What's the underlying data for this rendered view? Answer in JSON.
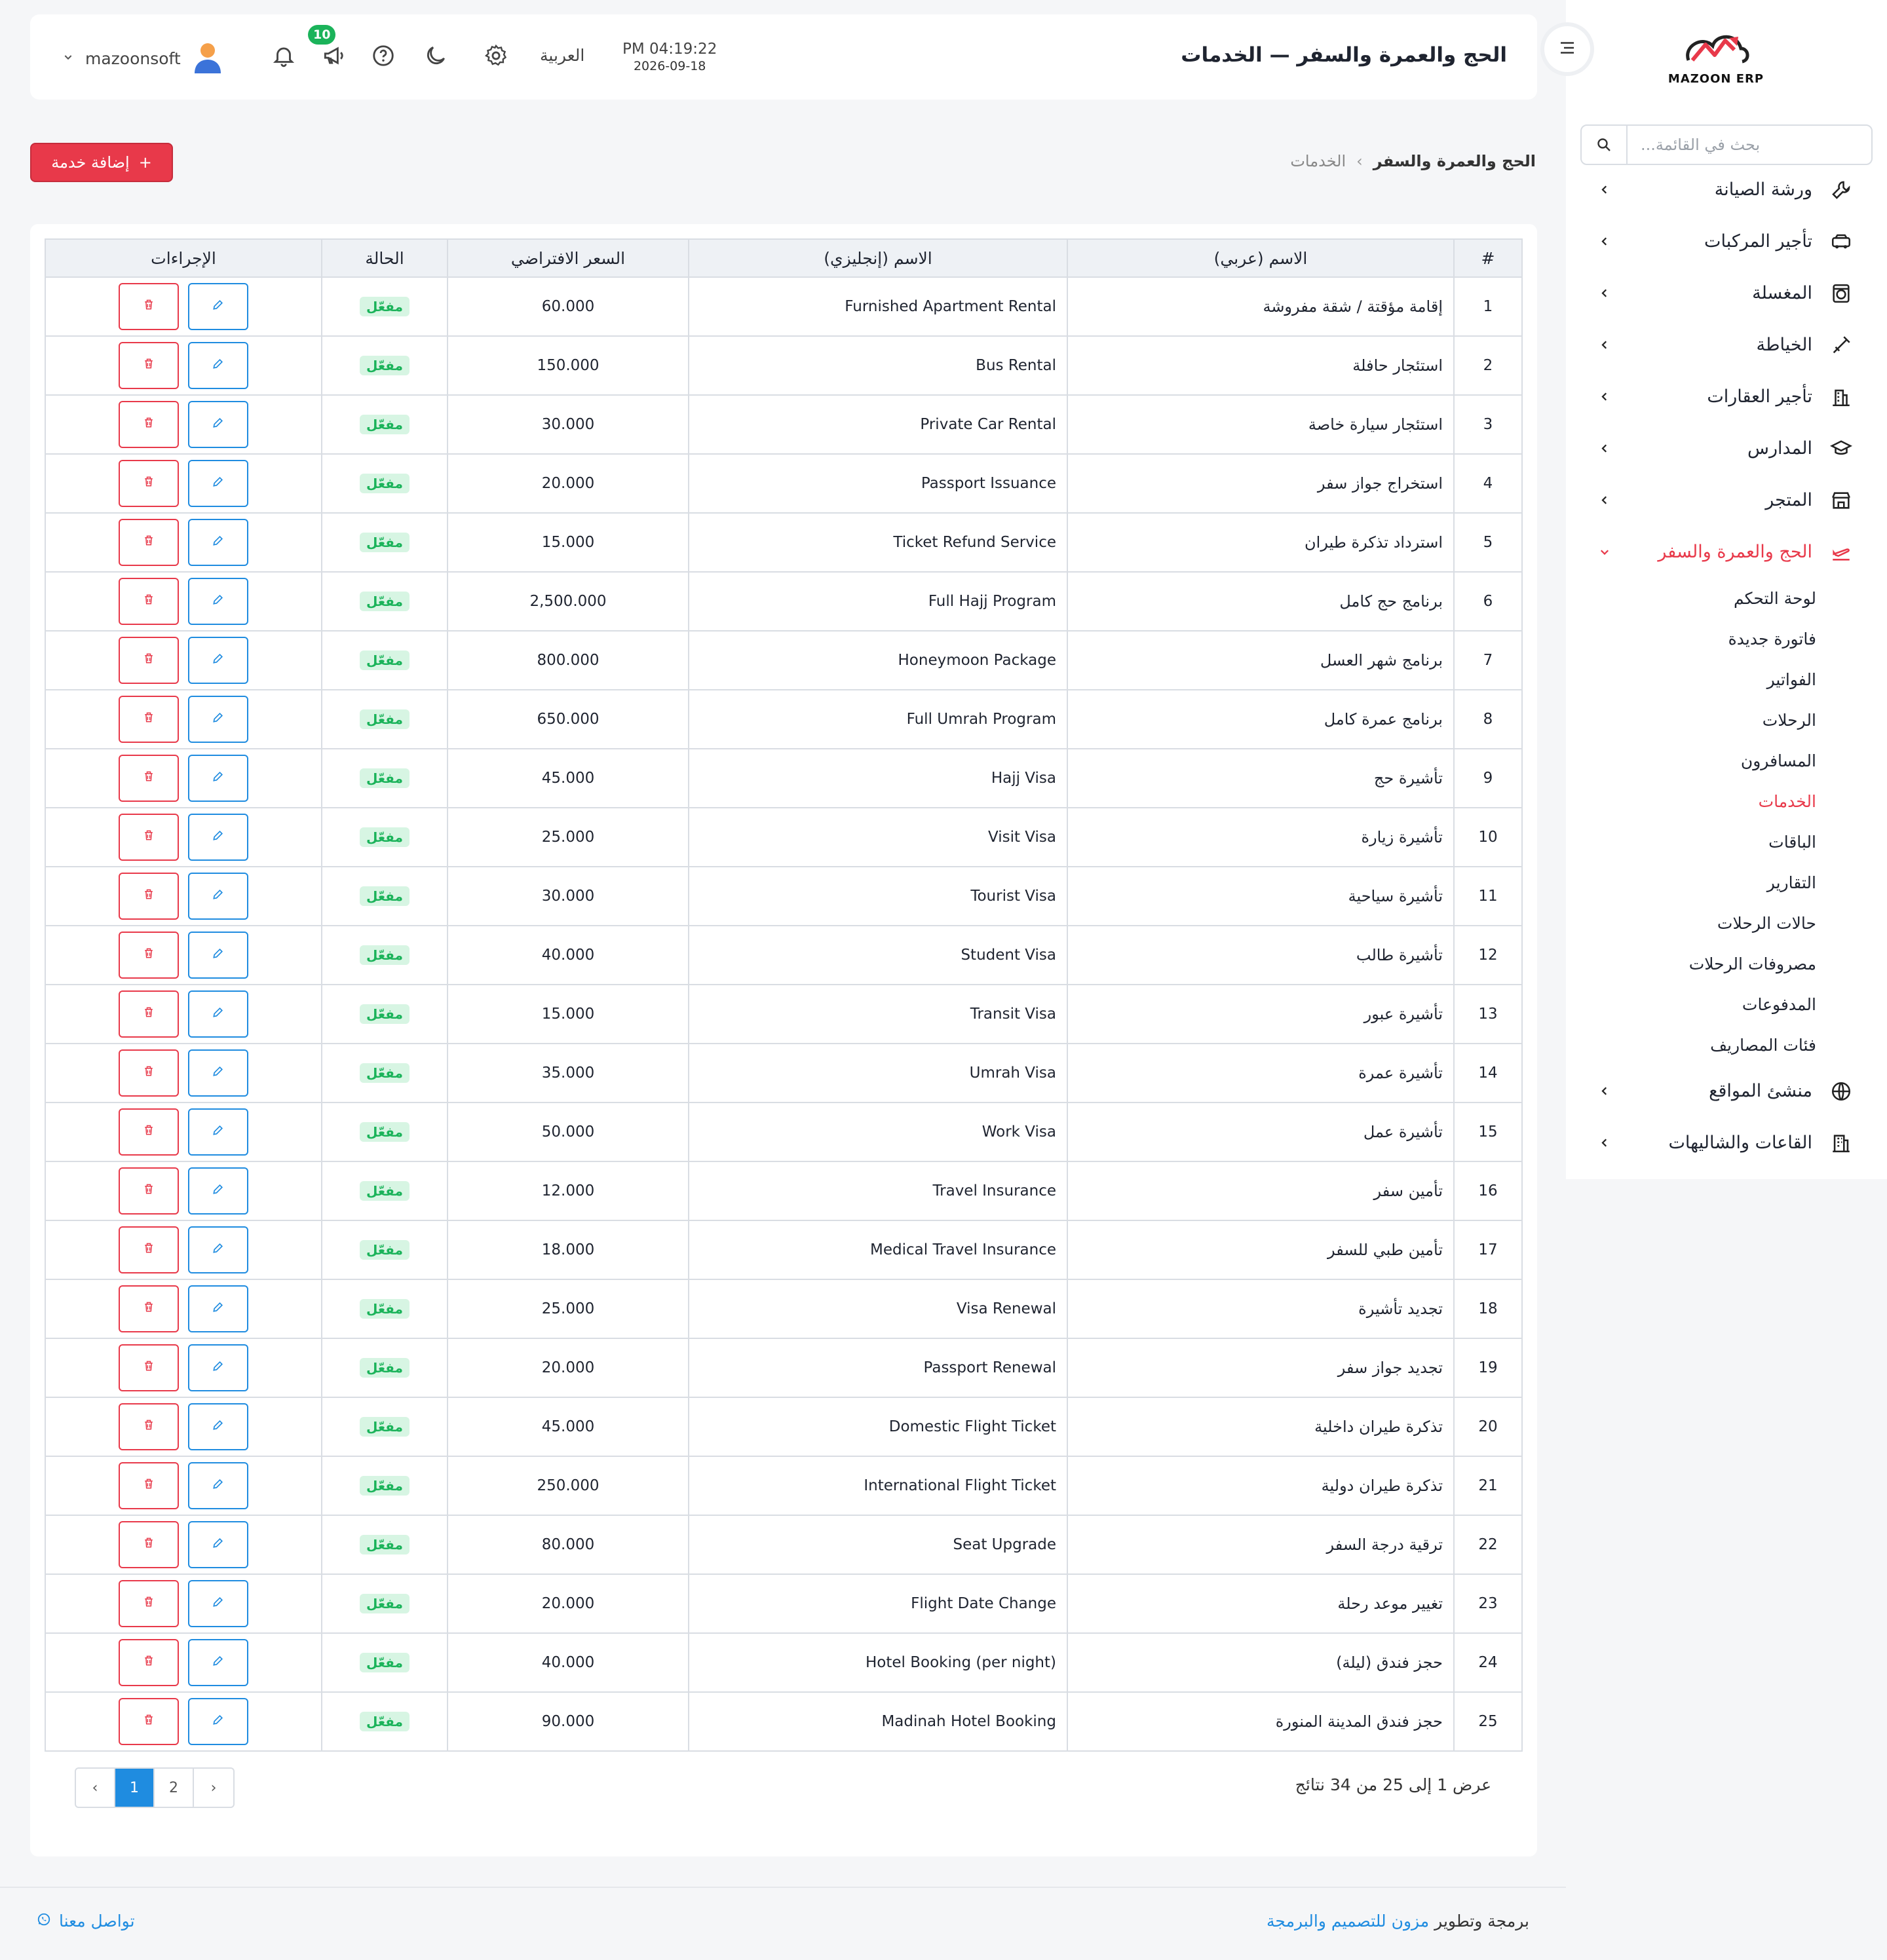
{
  "app": {
    "logo_text": "MAZOON ERP"
  },
  "sidebar": {
    "search_placeholder": "بحث في القائمة...",
    "items": [
      {
        "label": "ورشة الصيانة",
        "icon": "wrench-icon"
      },
      {
        "label": "تأجير المركبات",
        "icon": "car-icon"
      },
      {
        "label": "المغسلة",
        "icon": "washer-icon"
      },
      {
        "label": "الخياطة",
        "icon": "needle-icon"
      },
      {
        "label": "تأجير العقارات",
        "icon": "building-icon"
      },
      {
        "label": "المدارس",
        "icon": "graduation-cap-icon"
      },
      {
        "label": "المتجر",
        "icon": "store-icon"
      },
      {
        "label": "الحج والعمرة والسفر",
        "icon": "plane-icon"
      },
      {
        "label": "منشئ المواقع",
        "icon": "globe-icon"
      },
      {
        "label": "القاعات والشاليهات",
        "icon": "hall-icon"
      }
    ],
    "submenu": [
      "لوحة التحكم",
      "فاتورة جديدة",
      "الفواتير",
      "الرحلات",
      "المسافرون",
      "الخدمات",
      "الباقات",
      "التقارير",
      "حالات الرحلات",
      "مصروفات الرحلات",
      "المدفوعات",
      "فئات المصاريف"
    ],
    "active_sub_index": 5
  },
  "header": {
    "title": "الحج والعمرة والسفر — الخدمات",
    "time": "PM 04:19:22",
    "date": "2026-09-18",
    "language": "العربية",
    "notifications_count": "10",
    "username": "mazoonsoft"
  },
  "breadcrumb": {
    "parent": "الحج والعمرة والسفر",
    "current": "الخدمات",
    "separator": "›"
  },
  "add_button": {
    "label": "إضافة خدمة",
    "plus": "+"
  },
  "table": {
    "headers": {
      "num": "#",
      "name_ar": "الاسم (عربي)",
      "name_en": "الاسم (إنجليزي)",
      "price": "السعر الافتراضي",
      "status": "الحالة",
      "actions": "الإجراءات"
    },
    "status_label": "مفعّل",
    "rows": [
      {
        "num": "1",
        "ar": "إقامة مؤقتة / شقة مفروشة",
        "en": "Furnished Apartment Rental",
        "price": "60.000"
      },
      {
        "num": "2",
        "ar": "استئجار حافلة",
        "en": "Bus Rental",
        "price": "150.000"
      },
      {
        "num": "3",
        "ar": "استئجار سيارة خاصة",
        "en": "Private Car Rental",
        "price": "30.000"
      },
      {
        "num": "4",
        "ar": "استخراج جواز سفر",
        "en": "Passport Issuance",
        "price": "20.000"
      },
      {
        "num": "5",
        "ar": "استرداد تذكرة طيران",
        "en": "Ticket Refund Service",
        "price": "15.000"
      },
      {
        "num": "6",
        "ar": "برنامج حج كامل",
        "en": "Full Hajj Program",
        "price": "2,500.000"
      },
      {
        "num": "7",
        "ar": "برنامج شهر العسل",
        "en": "Honeymoon Package",
        "price": "800.000"
      },
      {
        "num": "8",
        "ar": "برنامج عمرة كامل",
        "en": "Full Umrah Program",
        "price": "650.000"
      },
      {
        "num": "9",
        "ar": "تأشيرة حج",
        "en": "Hajj Visa",
        "price": "45.000"
      },
      {
        "num": "10",
        "ar": "تأشيرة زيارة",
        "en": "Visit Visa",
        "price": "25.000"
      },
      {
        "num": "11",
        "ar": "تأشيرة سياحية",
        "en": "Tourist Visa",
        "price": "30.000"
      },
      {
        "num": "12",
        "ar": "تأشيرة طالب",
        "en": "Student Visa",
        "price": "40.000"
      },
      {
        "num": "13",
        "ar": "تأشيرة عبور",
        "en": "Transit Visa",
        "price": "15.000"
      },
      {
        "num": "14",
        "ar": "تأشيرة عمرة",
        "en": "Umrah Visa",
        "price": "35.000"
      },
      {
        "num": "15",
        "ar": "تأشيرة عمل",
        "en": "Work Visa",
        "price": "50.000"
      },
      {
        "num": "16",
        "ar": "تأمين سفر",
        "en": "Travel Insurance",
        "price": "12.000"
      },
      {
        "num": "17",
        "ar": "تأمين طبي للسفر",
        "en": "Medical Travel Insurance",
        "price": "18.000"
      },
      {
        "num": "18",
        "ar": "تجديد تأشيرة",
        "en": "Visa Renewal",
        "price": "25.000"
      },
      {
        "num": "19",
        "ar": "تجديد جواز سفر",
        "en": "Passport Renewal",
        "price": "20.000"
      },
      {
        "num": "20",
        "ar": "تذكرة طيران داخلية",
        "en": "Domestic Flight Ticket",
        "price": "45.000"
      },
      {
        "num": "21",
        "ar": "تذكرة طيران دولية",
        "en": "International Flight Ticket",
        "price": "250.000"
      },
      {
        "num": "22",
        "ar": "ترقية درجة السفر",
        "en": "Seat Upgrade",
        "price": "80.000"
      },
      {
        "num": "23",
        "ar": "تغيير موعد رحلة",
        "en": "Flight Date Change",
        "price": "20.000"
      },
      {
        "num": "24",
        "ar": "حجز فندق (ليلة)",
        "en": "Hotel Booking (per night)",
        "price": "40.000"
      },
      {
        "num": "25",
        "ar": "حجز فندق المدينة المنورة",
        "en": "Madinah Hotel Booking",
        "price": "90.000"
      }
    ]
  },
  "pagination": {
    "info": "عرض 1 إلى 25 من 34 نتائج",
    "prev": "‹",
    "pages": [
      "1",
      "2"
    ],
    "current": "1",
    "next": "›"
  },
  "footer": {
    "prefix": "برمجة وتطوير ",
    "link": "مزون للتصميم والبرمجة",
    "contact": "تواصل معنا"
  },
  "colors": {
    "accent": "#e8394a",
    "blue": "#1f8ce0",
    "green": "#1bb35a"
  }
}
